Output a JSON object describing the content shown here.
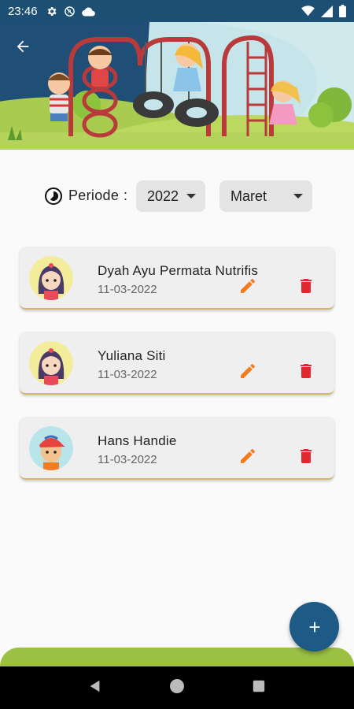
{
  "status_bar": {
    "time": "23:46",
    "icons": [
      "gear-icon",
      "no-data-icon",
      "cloud-icon",
      "wifi-icon",
      "signal-icon",
      "battery-icon"
    ]
  },
  "header": {
    "back_icon": "arrow-back-icon"
  },
  "period": {
    "label": "Periode",
    "colon": ":",
    "year": "2022",
    "month": "Maret"
  },
  "records": [
    {
      "name": "Dyah Ayu Permata Nutrifis",
      "date": "11-03-2022",
      "avatar": "girl"
    },
    {
      "name": "Yuliana Siti",
      "date": "11-03-2022",
      "avatar": "girl"
    },
    {
      "name": "Hans Handie",
      "date": "11-03-2022",
      "avatar": "boy"
    }
  ],
  "colors": {
    "primary": "#1d5a85",
    "edit": "#f47c20",
    "delete": "#e0282e",
    "footer": "#9bc043"
  },
  "fab": {
    "icon": "plus-icon"
  },
  "nav": {
    "icons": [
      "back-triangle-icon",
      "home-circle-icon",
      "recents-square-icon"
    ]
  }
}
